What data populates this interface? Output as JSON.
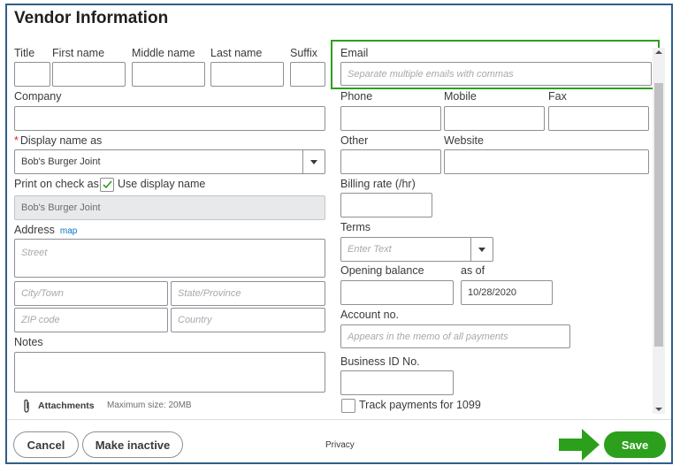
{
  "dialog": {
    "title": "Vendor Information"
  },
  "name": {
    "title_label": "Title",
    "first_label": "First name",
    "middle_label": "Middle name",
    "last_label": "Last name",
    "suffix_label": "Suffix"
  },
  "email": {
    "label": "Email",
    "placeholder": "Separate multiple emails with commas"
  },
  "company": {
    "label": "Company"
  },
  "phone": {
    "label": "Phone"
  },
  "mobile": {
    "label": "Mobile"
  },
  "fax": {
    "label": "Fax"
  },
  "display_name": {
    "label": "Display name as",
    "value": "Bob's Burger Joint"
  },
  "other": {
    "label": "Other"
  },
  "website": {
    "label": "Website"
  },
  "print_on_check": {
    "label": "Print on check as",
    "checkbox_label": "Use display name",
    "checked": true,
    "value": "Bob's Burger Joint"
  },
  "billing_rate": {
    "label": "Billing rate (/hr)"
  },
  "address": {
    "label": "Address",
    "map_link": "map",
    "street_placeholder": "Street",
    "city_placeholder": "City/Town",
    "state_placeholder": "State/Province",
    "zip_placeholder": "ZIP code",
    "country_placeholder": "Country"
  },
  "terms": {
    "label": "Terms",
    "placeholder": "Enter Text"
  },
  "opening_balance": {
    "label": "Opening balance",
    "as_of_label": "as of",
    "date_value": "10/28/2020"
  },
  "account_no": {
    "label": "Account no.",
    "placeholder": "Appears in the memo of all payments"
  },
  "notes": {
    "label": "Notes"
  },
  "business_id": {
    "label": "Business ID No."
  },
  "track_1099": {
    "label": "Track payments for 1099",
    "checked": false
  },
  "attachments": {
    "label": "Attachments",
    "max_size": "Maximum size: 20MB"
  },
  "footer": {
    "cancel": "Cancel",
    "make_inactive": "Make inactive",
    "privacy": "Privacy",
    "save": "Save"
  },
  "colors": {
    "accent_green": "#2ca01c",
    "link_blue": "#0077c5",
    "required_red": "#d52b1e",
    "frame_border": "#2f5f8a"
  }
}
